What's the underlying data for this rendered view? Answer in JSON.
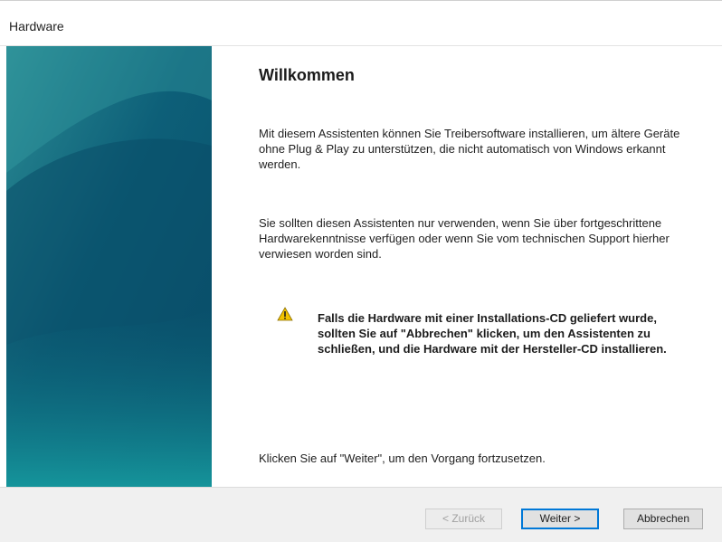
{
  "window": {
    "title": "Hardware"
  },
  "main": {
    "heading": "Willkommen",
    "paragraph1": "Mit diesem Assistenten können Sie Treibersoftware installieren, um ältere Geräte ohne Plug & Play zu unterstützen, die nicht automatisch von Windows erkannt werden.",
    "paragraph2": "Sie sollten diesen Assistenten nur verwenden, wenn Sie über fortgeschrittene Hardwarekenntnisse verfügen oder wenn Sie vom technischen Support hierher verwiesen worden sind.",
    "warning": "Falls die Hardware mit einer Installations-CD geliefert wurde, sollten Sie auf \"Abbrechen\" klicken, um den Assistenten zu schließen, und die Hardware mit der Hersteller-CD installieren.",
    "paragraph3": "Klicken Sie auf \"Weiter\", um den Vorgang fortzusetzen."
  },
  "buttons": {
    "back": "< Zurück",
    "next": "Weiter >",
    "cancel": "Abbrechen"
  },
  "icons": {
    "warning": "warning-triangle-icon"
  },
  "colors": {
    "side_panel_dark": "#0b4f6b",
    "side_panel_light": "#1a9aa0",
    "warning_yellow": "#f2c200",
    "next_button_border": "#0078d7"
  }
}
